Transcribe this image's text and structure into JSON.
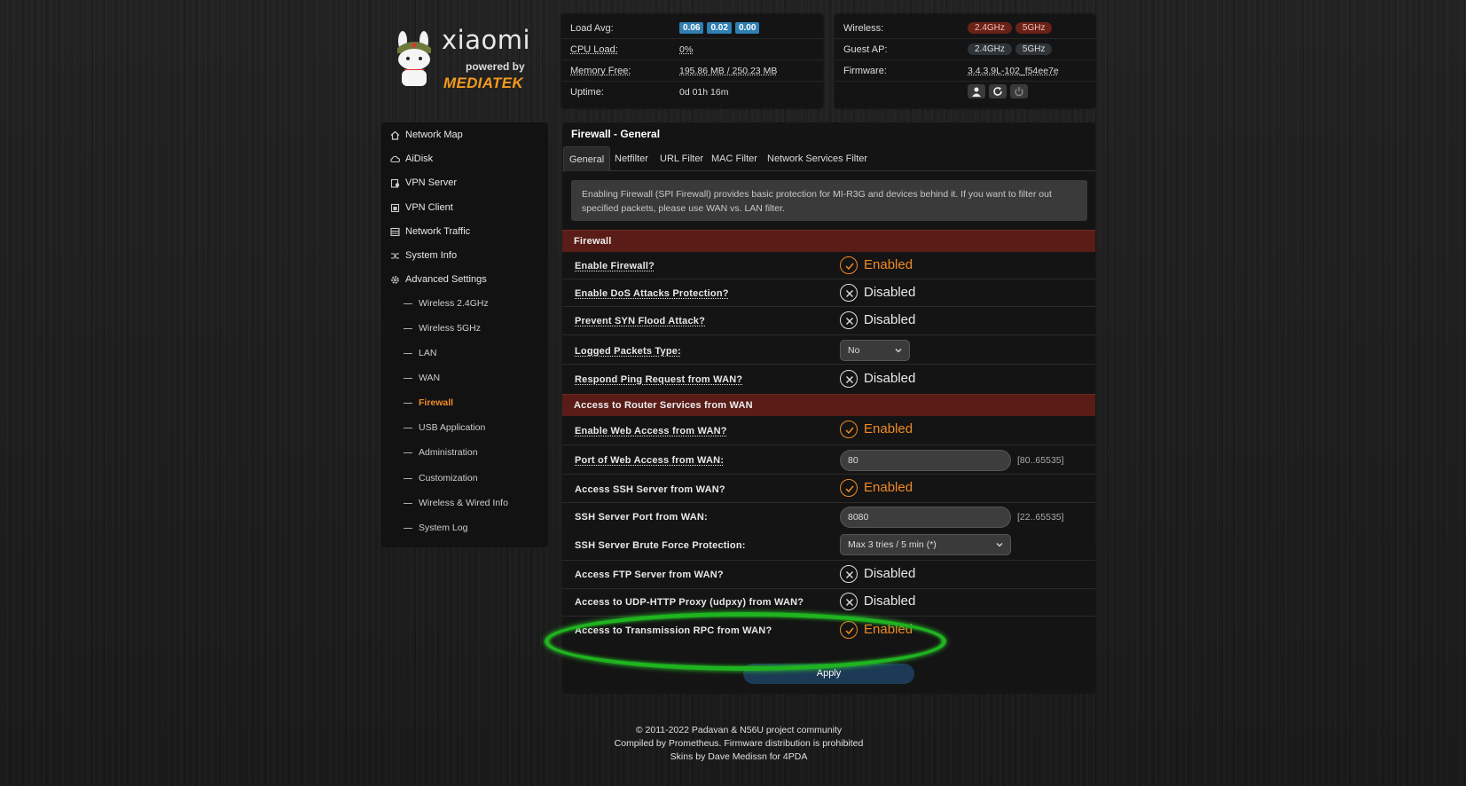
{
  "logo": {
    "brand": "xiaomi",
    "powered": "powered by",
    "vendor": "MEDIATEK"
  },
  "status": {
    "load_avg_label": "Load Avg:",
    "load_avg": [
      "0.06",
      "0.02",
      "0.00"
    ],
    "cpu_label": "CPU Load:",
    "cpu": "0%",
    "mem_label": "Memory Free:",
    "mem": "195.86 MB / 250.23 MB",
    "uptime_label": "Uptime:",
    "uptime": "0d 01h 16m",
    "wireless_label": "Wireless:",
    "wireless_bands": [
      "2.4GHz",
      "5GHz"
    ],
    "guest_label": "Guest AP:",
    "guest_bands": [
      "2.4GHz",
      "5GHz"
    ],
    "firmware_label": "Firmware:",
    "firmware": "3.4.3.9L-102_f54ee7e",
    "icons": [
      "user-icon",
      "refresh-icon",
      "power-icon"
    ]
  },
  "sidebar": {
    "items": [
      {
        "label": "Network Map",
        "icon": "home-icon"
      },
      {
        "label": "AiDisk",
        "icon": "cloud-icon"
      },
      {
        "label": "VPN Server",
        "icon": "vpn-server-icon"
      },
      {
        "label": "VPN Client",
        "icon": "vpn-client-icon"
      },
      {
        "label": "Network Traffic",
        "icon": "traffic-icon"
      },
      {
        "label": "System Info",
        "icon": "shuffle-icon"
      },
      {
        "label": "Advanced Settings",
        "icon": "gear-icon"
      }
    ],
    "sub_items": [
      {
        "label": "Wireless 2.4GHz"
      },
      {
        "label": "Wireless 5GHz"
      },
      {
        "label": "LAN"
      },
      {
        "label": "WAN"
      },
      {
        "label": "Firewall",
        "active": true
      },
      {
        "label": "USB Application"
      },
      {
        "label": "Administration"
      },
      {
        "label": "Customization"
      },
      {
        "label": "Wireless & Wired Info"
      },
      {
        "label": "System Log"
      }
    ]
  },
  "main": {
    "title": "Firewall - General",
    "tabs": [
      "General",
      "Netfilter",
      "URL Filter",
      "MAC Filter",
      "Network Services Filter"
    ],
    "info": "Enabling Firewall (SPI Firewall) provides basic protection for MI-R3G and devices behind it. If you want to filter out specified packets, please use WAN vs. LAN filter.",
    "section1": "Firewall",
    "section2": "Access to Router Services from WAN",
    "enabled_text": "Enabled",
    "disabled_text": "Disabled",
    "rows": {
      "enable_firewall": "Enable Firewall?",
      "dos": "Enable DoS Attacks Protection?",
      "syn": "Prevent SYN Flood Attack?",
      "logged": "Logged Packets Type:",
      "logged_value": "No",
      "ping": "Respond Ping Request from WAN?",
      "web_access": "Enable Web Access from WAN?",
      "web_port": "Port of Web Access from WAN:",
      "web_port_value": "80",
      "web_port_range": "[80..65535]",
      "ssh": "Access SSH Server from WAN?",
      "ssh_port": "SSH Server Port from WAN:",
      "ssh_port_value": "8080",
      "ssh_port_range": "[22..65535]",
      "brute": "SSH Server Brute Force Protection:",
      "brute_value": "Max 3 tries / 5 min (*)",
      "ftp": "Access FTP Server from WAN?",
      "udpxy": "Access to UDP-HTTP Proxy (udpxy) from WAN?",
      "transmission": "Access to Transmission RPC from WAN?"
    },
    "apply": "Apply"
  },
  "footer": {
    "line1": "© 2011-2022 Padavan & N56U project community",
    "line2": "Compiled by Prometheus. Firmware distribution is prohibited",
    "line3": "Skins by Dave Medissn for 4PDA"
  },
  "colors": {
    "accent": "#f08a24",
    "section": "#5a1c17",
    "highlight": "#1fb41f"
  }
}
